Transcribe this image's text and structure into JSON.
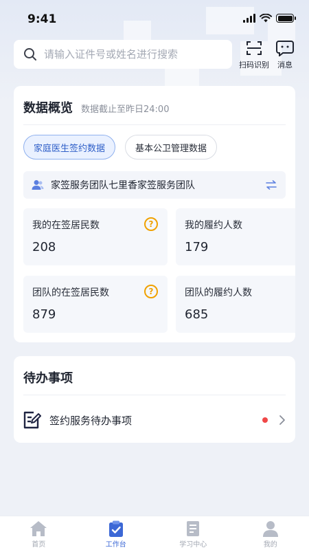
{
  "status_bar": {
    "time": "9:41"
  },
  "search": {
    "placeholder": "请输入证件号或姓名进行搜索",
    "value": ""
  },
  "top_actions": {
    "scan_label": "扫码识别",
    "message_label": "消息"
  },
  "overview": {
    "title": "数据概览",
    "subtitle": "数据截止至昨日24:00",
    "tabs": [
      {
        "label": "家庭医生签约数据",
        "active": true
      },
      {
        "label": "基本公卫管理数据",
        "active": false
      }
    ],
    "team_name": "家签服务团队七里香家签服务团队",
    "stats": [
      {
        "label": "我的在签居民数",
        "value": "208",
        "has_help": true
      },
      {
        "label": "我的履约人数",
        "value": "179",
        "has_help": false
      },
      {
        "label": "团队的在签居民数",
        "value": "879",
        "has_help": true
      },
      {
        "label": "团队的履约人数",
        "value": "685",
        "has_help": false
      }
    ]
  },
  "todo": {
    "title": "待办事项",
    "items": [
      {
        "label": "签约服务待办事项",
        "has_unread": true
      }
    ]
  },
  "tabbar": {
    "items": [
      {
        "label": "首页",
        "icon": "home-icon",
        "active": false
      },
      {
        "label": "工作台",
        "icon": "clipboard-check-icon",
        "active": true
      },
      {
        "label": "学习中心",
        "icon": "book-icon",
        "active": false
      },
      {
        "label": "我的",
        "icon": "user-icon",
        "active": false
      }
    ]
  },
  "colors": {
    "primary": "#3c68d6",
    "tab_active_bg": "#eaf1ff",
    "help": "#f0a100",
    "badge": "#f04848",
    "page_bg": "#eef1f7"
  }
}
